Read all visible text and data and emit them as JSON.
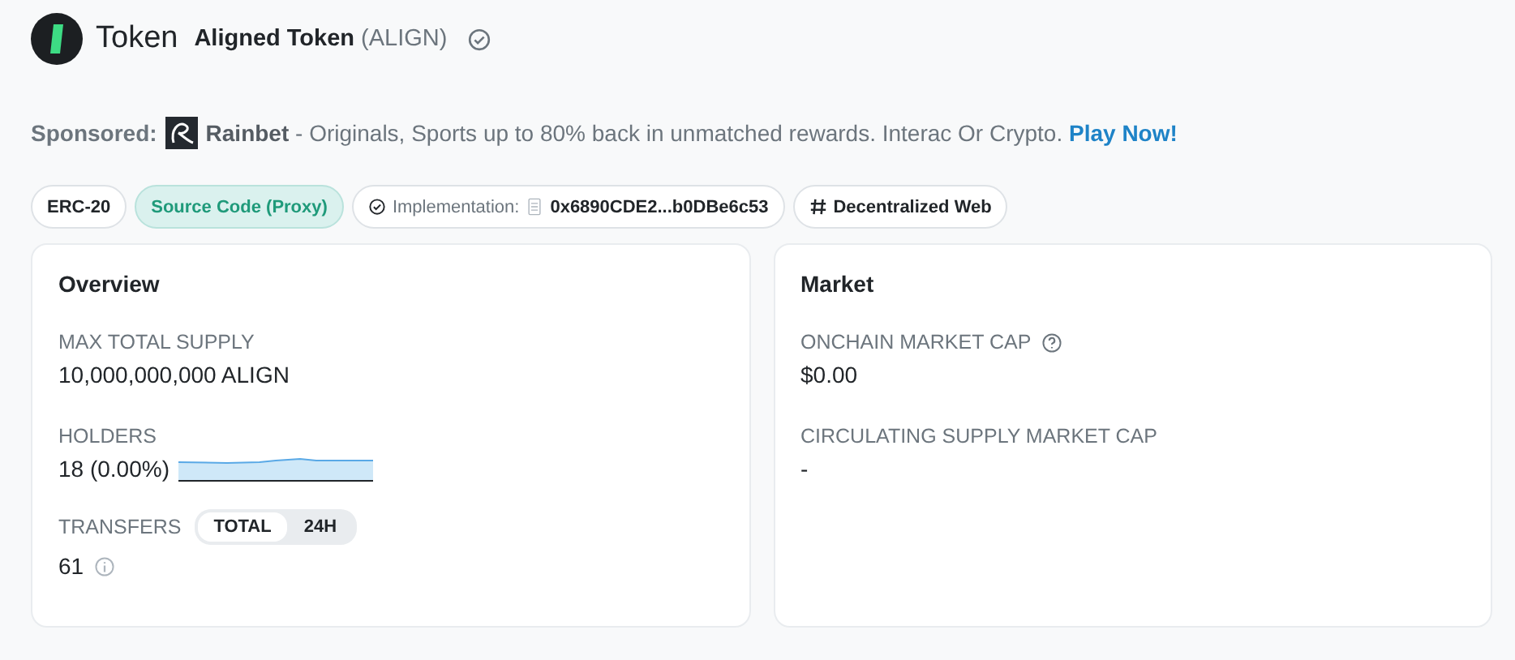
{
  "header": {
    "title": "Token",
    "name": "Aligned Token",
    "symbol": "(ALIGN)",
    "verified": true
  },
  "sponsored": {
    "label": "Sponsored:",
    "brand": "Rainbet",
    "text": " - Originals, Sports up to 80% back in unmatched rewards. Interac Or Crypto. ",
    "link": "Play Now!"
  },
  "chips": [
    {
      "kind": "plain",
      "label": "ERC-20"
    },
    {
      "kind": "highlight",
      "label": "Source Code (Proxy)"
    },
    {
      "kind": "implementation",
      "label": "Implementation:",
      "value": "0x6890CDE2...b0DBe6c53"
    },
    {
      "kind": "tag",
      "label": "Decentralized Web"
    }
  ],
  "overview": {
    "title": "Overview",
    "max_supply_label": "MAX TOTAL SUPPLY",
    "max_supply": "10,000,000,000 ALIGN",
    "holders_label": "HOLDERS",
    "holders": "18 (0.00%)",
    "transfers_label": "TRANSFERS",
    "transfer_tabs": [
      {
        "label": "TOTAL",
        "selected": true
      },
      {
        "label": "24H",
        "selected": false
      }
    ],
    "transfers": "61"
  },
  "market": {
    "title": "Market",
    "onchain_label": "ONCHAIN MARKET CAP",
    "onchain": "$0.00",
    "circ_label": "CIRCULATING SUPPLY MARKET CAP",
    "circ": "-"
  }
}
